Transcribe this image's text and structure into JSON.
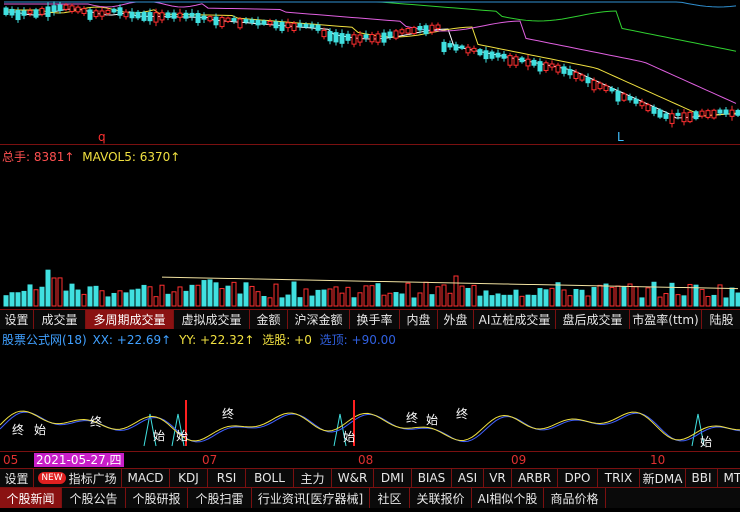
{
  "price_pane": {
    "low_marker": "q",
    "high_marker": "L",
    "colors": {
      "up": "#ff3030",
      "down": "#40e0e0",
      "ma1": "#ffffff",
      "ma2": "#f0e040",
      "ma3": "#e060e0",
      "ma4": "#30d030",
      "ma5": "#3090d0"
    }
  },
  "volume_pane": {
    "label_total": "总手: 8381↑",
    "label_mavol": "MAVOL5: 6370↑",
    "colors": {
      "total": "#ff5050",
      "mavol": "#f0e040"
    }
  },
  "volume_tabs": [
    "设置",
    "成交量",
    "多周期成交量",
    "虚拟成交量",
    "金额",
    "沪深金额",
    "换手率",
    "内盘",
    "外盘",
    "AI立桩成交量",
    "盘后成交量",
    "市盈率(ttm)",
    "陆股"
  ],
  "volume_active_tab": "多周期成交量",
  "indicator_pane": {
    "label_name": "股票公式网(18)",
    "label_xx": "XX: +22.69↑",
    "label_yy": "YY: +22.32↑",
    "label_select": "选股: +0",
    "label_select2": "选顶: +90.00",
    "marks": {
      "zhong": "终",
      "zhi": "始"
    }
  },
  "x_axis": {
    "labels": [
      "05",
      "07",
      "08",
      "09",
      "10"
    ],
    "cursor_date": "2021-05-27,四"
  },
  "indicator_tabs": {
    "settings": "设置",
    "new_badge": "NEW",
    "items": [
      "指标广场",
      "MACD",
      "KDJ",
      "RSI",
      "BOLL",
      "主力",
      "W&R",
      "DMI",
      "BIAS",
      "ASI",
      "VR",
      "ARBR",
      "DPO",
      "TRIX",
      "新DMA",
      "BBI",
      "MTM"
    ]
  },
  "bottom_tabs": [
    "个股新闻",
    "个股公告",
    "个股研报",
    "个股扫雷",
    "行业资讯[医疗器械]",
    "社区",
    "关联报价",
    "AI相似个股",
    "商品价格"
  ],
  "bottom_active_tab": "个股新闻"
}
